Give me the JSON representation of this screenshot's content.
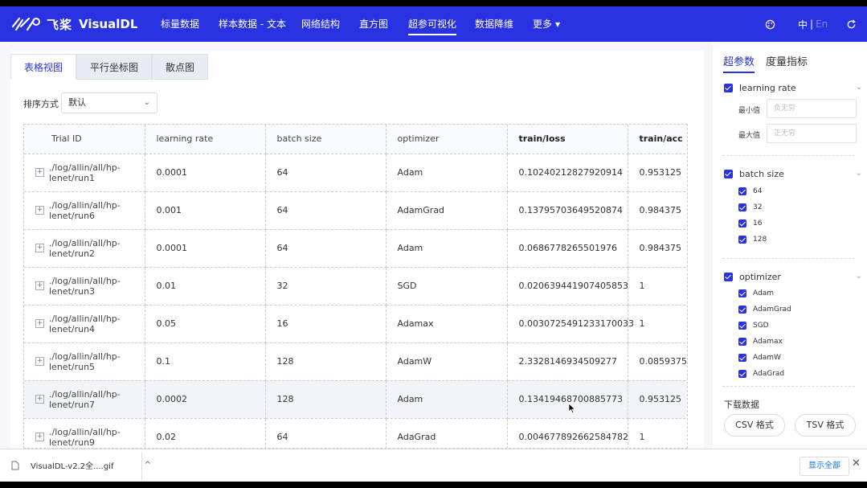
{
  "brand": {
    "cn": "飞桨",
    "en": "VisualDL"
  },
  "nav": {
    "items": [
      "标量数据",
      "样本数据 - 文本",
      "网络结构",
      "直方图",
      "超参可视化",
      "数据降维",
      "更多"
    ],
    "active_index": 4,
    "more_caret": "▾",
    "lang_cn": "中",
    "lang_sep": "|",
    "lang_en": "En"
  },
  "view_tabs": [
    "表格视图",
    "平行坐标图",
    "散点图"
  ],
  "sort": {
    "label": "排序方式",
    "value": "默认"
  },
  "table": {
    "headers": [
      "Trial ID",
      "learning rate",
      "batch size",
      "optimizer",
      "train/loss",
      "train/acc"
    ],
    "rows": [
      [
        "./log/allin/all/hp-",
        "lenet/run1",
        "0.0001",
        "64",
        "Adam",
        "0.10240212827920914",
        "0.953125"
      ],
      [
        "./log/allin/all/hp-",
        "lenet/run6",
        "0.001",
        "64",
        "AdamGrad",
        "0.13795703649520874",
        "0.984375"
      ],
      [
        "./log/allin/all/hp-",
        "lenet/run2",
        "0.0001",
        "64",
        "Adam",
        "0.0686778265501976",
        "0.984375"
      ],
      [
        "./log/allin/all/hp-",
        "lenet/run3",
        "0.01",
        "32",
        "SGD",
        "0.020639441907405853",
        "1"
      ],
      [
        "./log/allin/all/hp-",
        "lenet/run4",
        "0.05",
        "16",
        "Adamax",
        "0.0030725491233170033",
        "1"
      ],
      [
        "./log/allin/all/hp-",
        "lenet/run5",
        "0.1",
        "128",
        "AdamW",
        "2.3328146934509277",
        "0.0859375"
      ],
      [
        "./log/allin/all/hp-",
        "lenet/run7",
        "0.0002",
        "128",
        "Adam",
        "0.13419468700885773",
        "0.953125"
      ],
      [
        "./log/allin/all/hp-",
        "lenet/run9",
        "0.02",
        "64",
        "AdaGrad",
        "0.004677892662584782",
        "1"
      ]
    ],
    "expand_glyph": "+"
  },
  "sidebar": {
    "tabs": [
      "超参数",
      "度量指标"
    ],
    "learning_rate": {
      "label": "learning rate",
      "min_label": "最小值",
      "max_label": "最大值",
      "min_placeholder": "负无穷",
      "max_placeholder": "正无穷"
    },
    "batch_size": {
      "label": "batch size",
      "options": [
        "64",
        "32",
        "16",
        "128"
      ]
    },
    "optimizer": {
      "label": "optimizer",
      "options": [
        "Adam",
        "AdamGrad",
        "SGD",
        "Adamax",
        "AdamW",
        "AdaGrad"
      ]
    },
    "download": {
      "title": "下载数据",
      "csv": "CSV 格式",
      "tsv": "TSV 格式"
    }
  },
  "download_bar": {
    "file": "VisualDL-v2.2全....gif",
    "show_all": "显示全部",
    "close": "✕",
    "caret": "^"
  },
  "colors": {
    "brand": "#2932e1",
    "link": "#1a73e8"
  }
}
